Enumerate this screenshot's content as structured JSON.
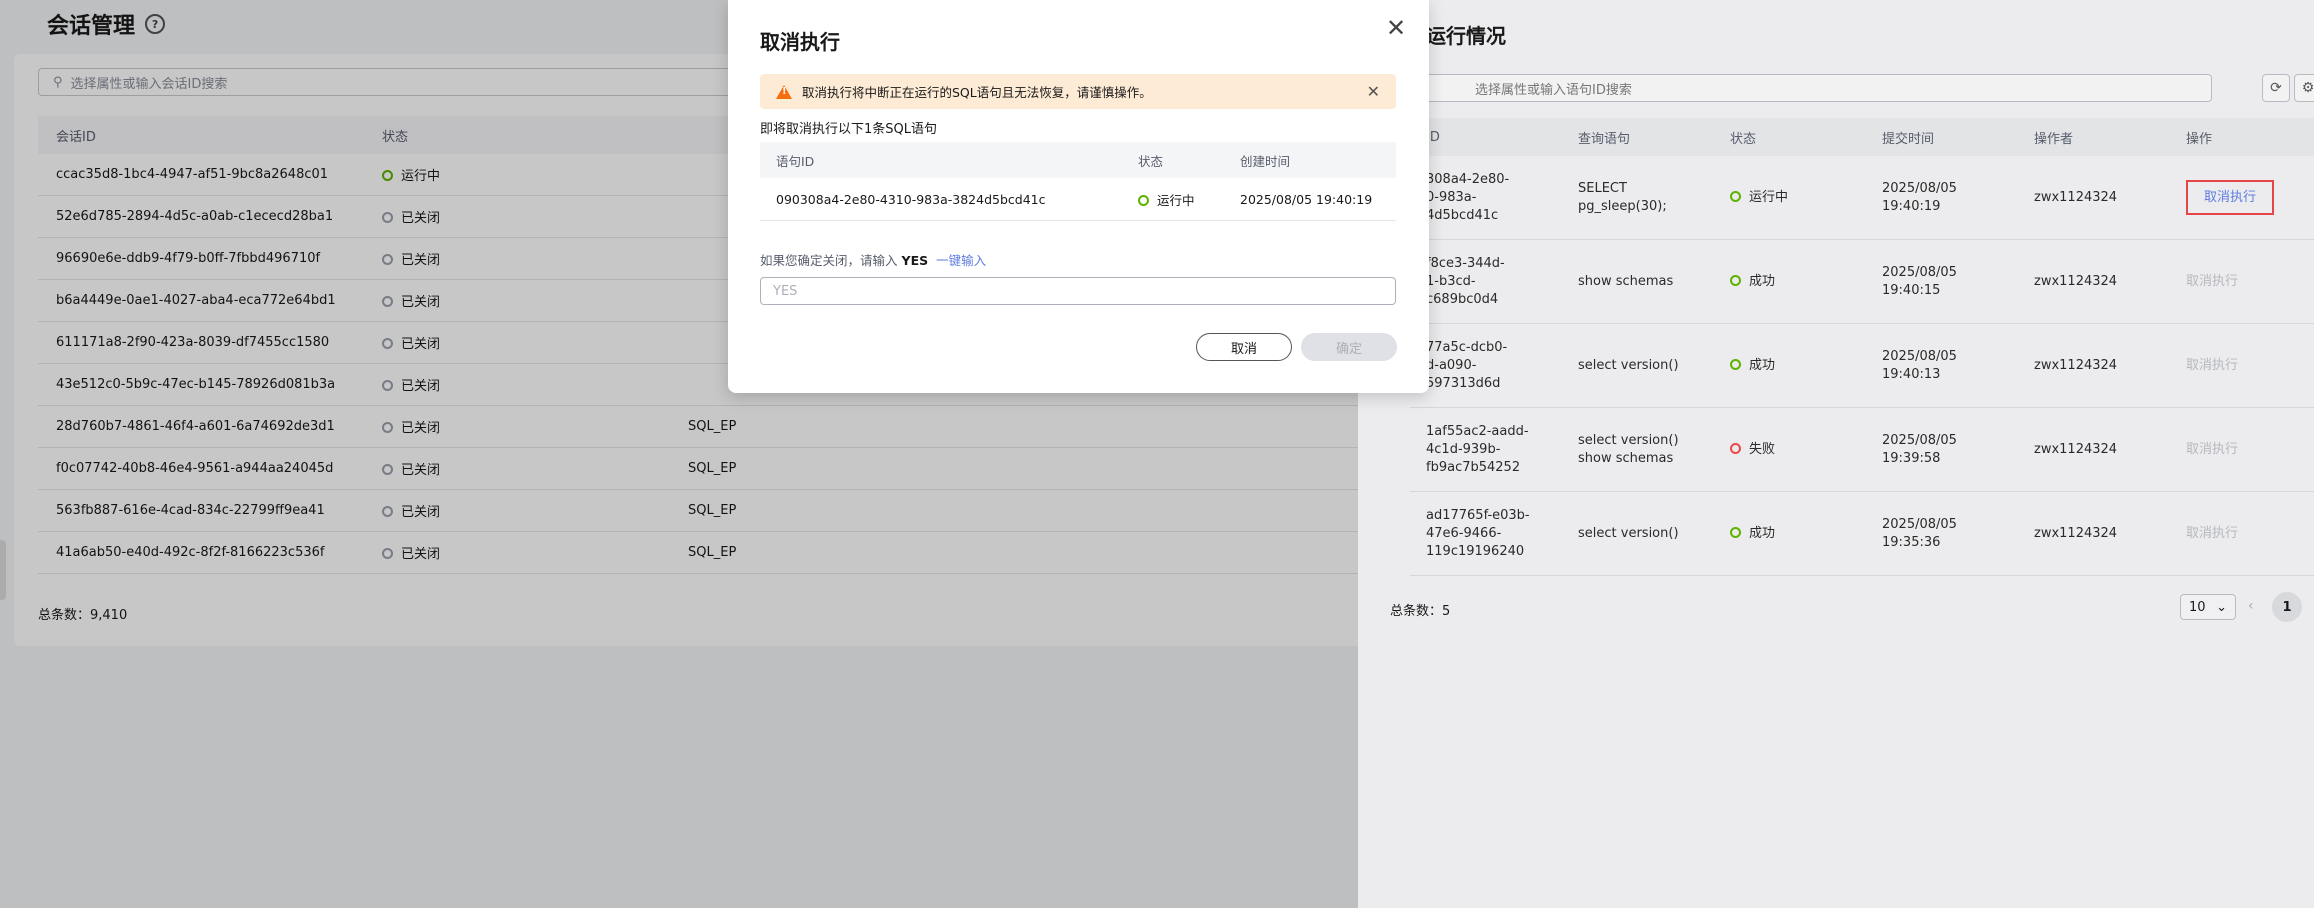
{
  "page": {
    "title": "会话管理"
  },
  "session_search": {
    "placeholder": "选择属性或输入会话ID搜索"
  },
  "session_table": {
    "headers": [
      "会话ID",
      "状态",
      "",
      ""
    ],
    "rows": [
      {
        "id": "ccac35d8-1bc4-4947-af51-9bc8a2648c01",
        "status": "运行中",
        "status_type": "run",
        "col3": ""
      },
      {
        "id": "52e6d785-2894-4d5c-a0ab-c1ececd28ba1",
        "status": "已关闭",
        "status_type": "off",
        "col3": ""
      },
      {
        "id": "96690e6e-ddb9-4f79-b0ff-7fbbd496710f",
        "status": "已关闭",
        "status_type": "off",
        "col3": ""
      },
      {
        "id": "b6a4449e-0ae1-4027-aba4-eca772e64bd1",
        "status": "已关闭",
        "status_type": "off",
        "col3": ""
      },
      {
        "id": "611171a8-2f90-423a-8039-df7455cc1580",
        "status": "已关闭",
        "status_type": "off",
        "col3": ""
      },
      {
        "id": "43e512c0-5b9c-47ec-b145-78926d081b3a",
        "status": "已关闭",
        "status_type": "off",
        "col3": ""
      },
      {
        "id": "28d760b7-4861-46f4-a601-6a74692de3d1",
        "status": "已关闭",
        "status_type": "off",
        "col3": "SQL_EP"
      },
      {
        "id": "f0c07742-40b8-46e4-9561-a944aa24045d",
        "status": "已关闭",
        "status_type": "off",
        "col3": "SQL_EP"
      },
      {
        "id": "563fb887-616e-4cad-834c-22799ff9ea41",
        "status": "已关闭",
        "status_type": "off",
        "col3": "SQL_EP"
      },
      {
        "id": "41a6ab50-e40d-492c-8f2f-8166223c536f",
        "status": "已关闭",
        "status_type": "off",
        "col3": "SQL_EP"
      }
    ],
    "total": "总条数：9,410"
  },
  "drawer": {
    "title": "运行情况",
    "search_placeholder": "选择属性或输入语句ID搜索",
    "headers": [
      "ID",
      "查询语句",
      "状态",
      "提交时间",
      "操作者",
      "操作"
    ],
    "rows": [
      {
        "id_lines": [
          "308a4-2e80-",
          "0-983a-",
          "4d5bcd41c"
        ],
        "query_lines": [
          "SELECT",
          "pg_sleep(30);"
        ],
        "status": "运行中",
        "status_type": "run",
        "time": "2025/08/05 19:40:19",
        "operator": "zwx1124324",
        "action": "取消执行",
        "action_enabled": true
      },
      {
        "id_lines": [
          "f8ce3-344d-",
          "1-b3cd-",
          "c689bc0d4"
        ],
        "query_lines": [
          "show schemas"
        ],
        "status": "成功",
        "status_type": "ok",
        "time": "2025/08/05 19:40:15",
        "operator": "zwx1124324",
        "action": "取消执行",
        "action_enabled": false
      },
      {
        "id_lines": [
          "77a5c-dcb0-",
          "d-a090-",
          "597313d6d"
        ],
        "query_lines": [
          "select version()"
        ],
        "status": "成功",
        "status_type": "ok",
        "time": "2025/08/05 19:40:13",
        "operator": "zwx1124324",
        "action": "取消执行",
        "action_enabled": false
      },
      {
        "id_lines": [
          "1af55ac2-aadd-",
          "4c1d-939b-",
          "fb9ac7b54252"
        ],
        "query_lines": [
          "select version()",
          "show schemas"
        ],
        "status": "失败",
        "status_type": "fail",
        "time": "2025/08/05 19:39:58",
        "operator": "zwx1124324",
        "action": "取消执行",
        "action_enabled": false
      },
      {
        "id_lines": [
          "ad17765f-e03b-",
          "47e6-9466-",
          "119c19196240"
        ],
        "query_lines": [
          "select version()"
        ],
        "status": "成功",
        "status_type": "ok",
        "time": "2025/08/05 19:35:36",
        "operator": "zwx1124324",
        "action": "取消执行",
        "action_enabled": false
      }
    ],
    "total": "总条数：5",
    "page_size": "10",
    "current_page": "1"
  },
  "modal": {
    "title": "取消执行",
    "warning": "取消执行将中断正在运行的SQL语句且无法恢复，请谨慎操作。",
    "subtitle": "即将取消执行以下1条SQL语句",
    "table_headers": [
      "语句ID",
      "状态",
      "创建时间"
    ],
    "table_row": {
      "id": "090308a4-2e80-4310-983a-3824d5bcd41c",
      "status": "运行中",
      "time": "2025/08/05 19:40:19"
    },
    "confirm_prefix": "如果您确定关闭，请输入",
    "confirm_keyword": "YES",
    "confirm_link": "一键输入",
    "input_placeholder": "YES",
    "cancel_label": "取消",
    "ok_label": "确定"
  },
  "colors": {
    "success": "#5cb300",
    "closed": "#9aa0ab",
    "failed": "#e84a4a",
    "link": "#5e7ce0",
    "warning_bg": "#fdebd5",
    "warning_icon": "#f66f0f"
  }
}
